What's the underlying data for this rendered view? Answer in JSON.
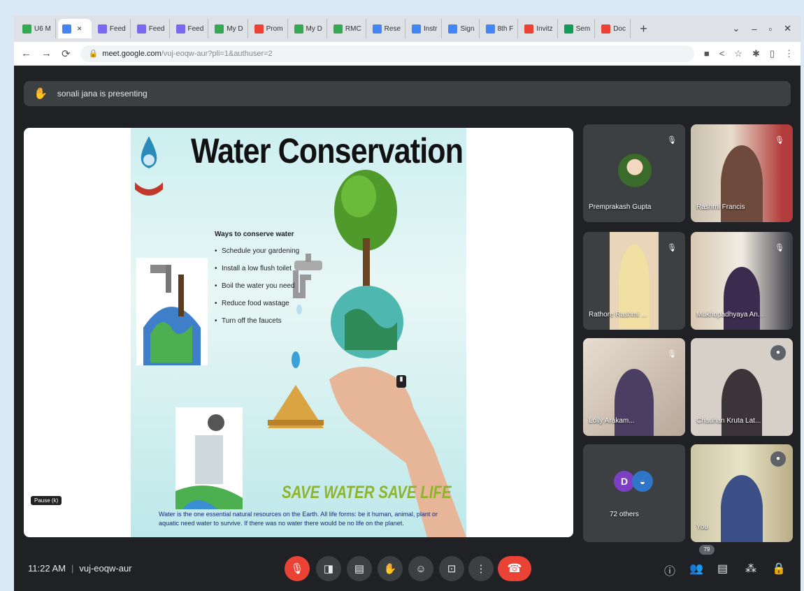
{
  "browser": {
    "tabs": [
      {
        "label": "U6 M",
        "color": "#34a853"
      },
      {
        "label": "",
        "color": "#4285f4",
        "active": true
      },
      {
        "label": "Feed",
        "color": "#7b68ee"
      },
      {
        "label": "Feed",
        "color": "#7b68ee"
      },
      {
        "label": "Feed",
        "color": "#7b68ee"
      },
      {
        "label": "My D",
        "color": "#34a853"
      },
      {
        "label": "Prom",
        "color": "#ea4335"
      },
      {
        "label": "My D",
        "color": "#34a853"
      },
      {
        "label": "RMC",
        "color": "#34a853"
      },
      {
        "label": "Rese",
        "color": "#4285f4"
      },
      {
        "label": "Instr",
        "color": "#4285f4"
      },
      {
        "label": "Sign",
        "color": "#4285f4"
      },
      {
        "label": "8th F",
        "color": "#4285f4"
      },
      {
        "label": "Invitz",
        "color": "#ea4335"
      },
      {
        "label": "Sem",
        "color": "#0f9d58"
      },
      {
        "label": "Doc",
        "color": "#ea4335"
      }
    ],
    "new_tab": "+",
    "url_host": "meet.google.com",
    "url_path": "/vuj-eoqw-aur?pli=1&authuser=2"
  },
  "meet": {
    "presenting_text": "sonali jana is presenting",
    "slide": {
      "title": "Water Conservation",
      "ways_heading": "Ways to conserve water",
      "ways": [
        "Schedule your gardening",
        "Install a low flush toilet",
        "Boil the water you need",
        "Reduce food wastage",
        "Turn off the faucets"
      ],
      "tagline": "SAVE WATER SAVE LIFE",
      "footer": "Water is the one essential natural resources on the Earth. All life forms: be it human, animal, plant or aquatic need water to survive. If there was no water there would be no life on the planet.",
      "label": "Pause (k)"
    },
    "participants": [
      {
        "name": "Premprakash Gupta",
        "type": "avatar"
      },
      {
        "name": "Rashmi Francis",
        "type": "camera"
      },
      {
        "name": "Rathore Rashmi ...",
        "type": "camera"
      },
      {
        "name": "Mukhopadhyaya An...",
        "type": "camera"
      },
      {
        "name": "Lolly Arakam...",
        "type": "camera"
      },
      {
        "name": "Chauhan Kruta Lat...",
        "type": "camera"
      },
      {
        "name": "72 others",
        "type": "others",
        "initial": "D"
      },
      {
        "name": "You",
        "type": "camera"
      }
    ],
    "time": "11:22 AM",
    "meeting_code": "vuj-eoqw-aur",
    "participant_count": "79"
  },
  "colors": {
    "end_call": "#ea4335",
    "tagline": "#8fb32d",
    "meet_bg": "#202124"
  }
}
